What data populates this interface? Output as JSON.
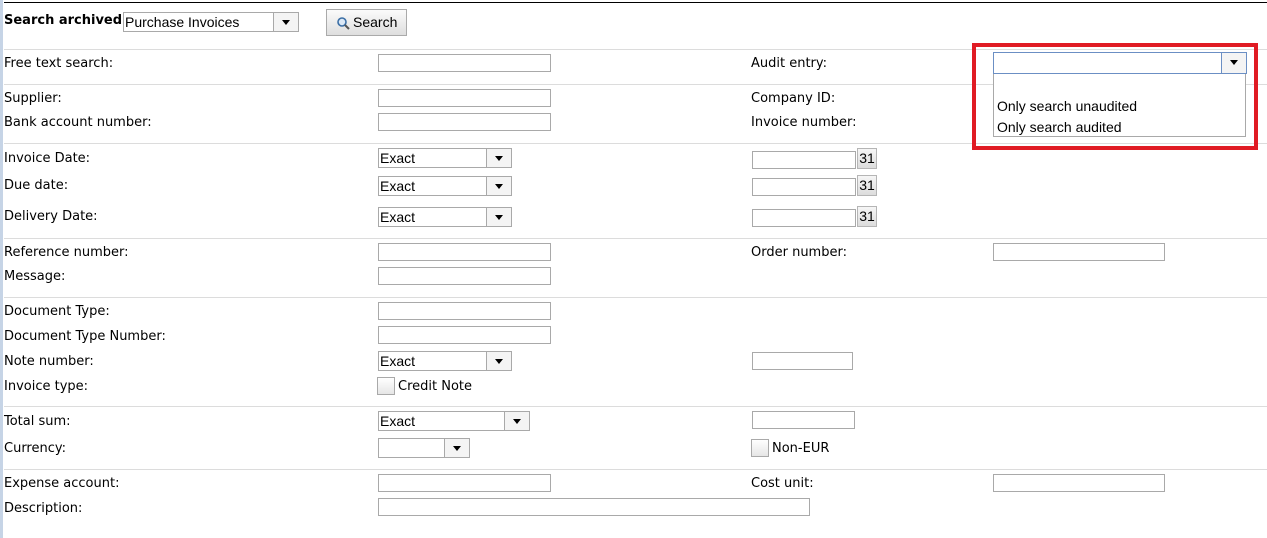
{
  "header": {
    "title": "Search archived",
    "archive_selected": "Purchase Invoices",
    "search_button": "Search"
  },
  "form": {
    "free_text_search": "Free text search:",
    "audit_entry": "Audit entry:",
    "supplier": "Supplier:",
    "company_id": "Company ID:",
    "bank_account_number": "Bank account number:",
    "invoice_number": "Invoice number:",
    "invoice_date": "Invoice Date:",
    "due_date": "Due date:",
    "delivery_date": "Delivery Date:",
    "reference_number": "Reference number:",
    "order_number": "Order number:",
    "message": "Message:",
    "document_type": "Document Type:",
    "document_type_number": "Document Type Number:",
    "note_number": "Note number:",
    "invoice_type": "Invoice type:",
    "credit_note": "Credit Note",
    "total_sum": "Total sum:",
    "currency": "Currency:",
    "non_eur": "Non-EUR",
    "expense_account": "Expense account:",
    "cost_unit": "Cost unit:",
    "description": "Description:",
    "match_mode": "Exact",
    "calendar_label": "31"
  },
  "audit_dropdown": {
    "selected": "",
    "options": [
      "Only search unaudited",
      "Only search audited"
    ]
  },
  "icons": {
    "search": "magnifier-icon",
    "calendar": "calendar-icon",
    "dropdown": "chevron-down-icon"
  },
  "colors": {
    "highlight": "#e01b24",
    "dropdown_accent": "#6b8fc4"
  }
}
